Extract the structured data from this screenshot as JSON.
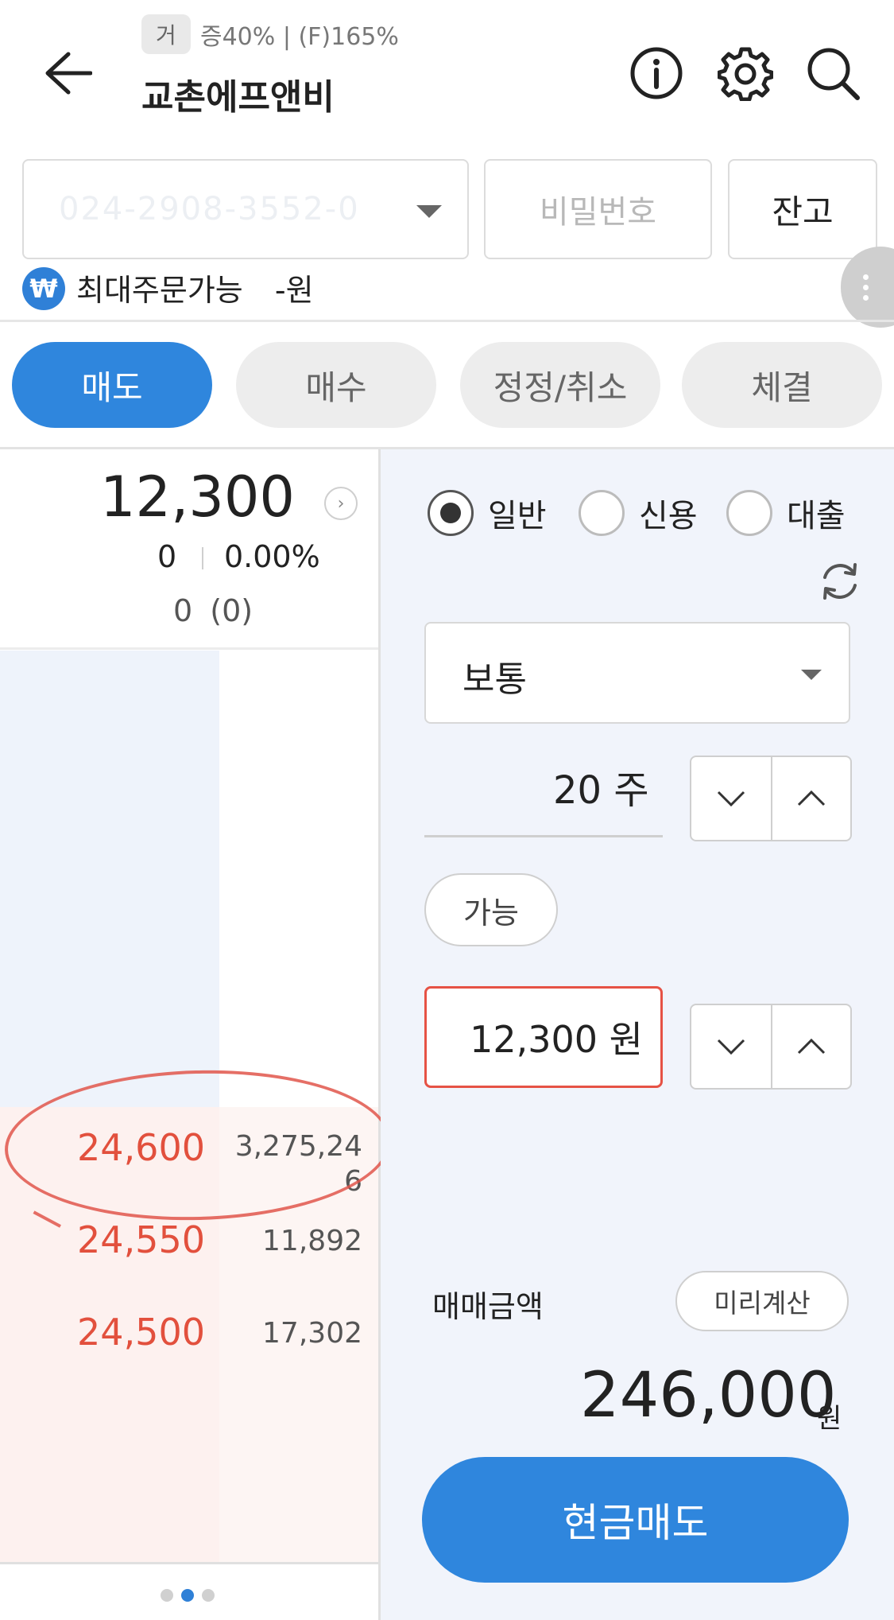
{
  "header": {
    "tag_chip": "거",
    "tag_info": "증40% | (F)165%",
    "stock_name": "교촌에프앤비",
    "icons": [
      "back-arrow-icon",
      "info-icon",
      "gear-icon",
      "search-icon"
    ]
  },
  "account": {
    "number": "024-2908-3552-0",
    "password_placeholder": "비밀번호",
    "balance_label": "잔고",
    "currency_symbol": "₩",
    "max_order_label": "최대주문가능",
    "max_order_value": "-원"
  },
  "tabs": [
    {
      "label": "매도",
      "active": true
    },
    {
      "label": "매수",
      "active": false
    },
    {
      "label": "정정/취소",
      "active": false
    },
    {
      "label": "체결",
      "active": false
    }
  ],
  "quote": {
    "current_price": "12,300",
    "change": "0",
    "change_pct": "0.00%",
    "volume": "0",
    "volume_paren": "(0)",
    "arrow": "›"
  },
  "orderbook": {
    "rows": [
      {
        "price": "24,600",
        "qty_line1": "3,275,24",
        "qty_line2": "6"
      },
      {
        "price": "24,550",
        "qty": "11,892"
      },
      {
        "price": "24,500",
        "qty": "17,302"
      }
    ]
  },
  "order_form": {
    "credit_options": [
      {
        "label": "일반",
        "checked": true
      },
      {
        "label": "신용",
        "checked": false
      },
      {
        "label": "대출",
        "checked": false
      }
    ],
    "order_type": "보통",
    "quantity": "20 주",
    "available_label": "가능",
    "price": "12,300 원",
    "amount_label": "매매금액",
    "precalc_label": "미리계산",
    "amount_value": "246,000",
    "amount_unit": "원",
    "submit_label": "현금매도"
  },
  "colors": {
    "accent": "#2f86dd",
    "ask_price": "#e2503d",
    "annotation": "#e0564b"
  }
}
